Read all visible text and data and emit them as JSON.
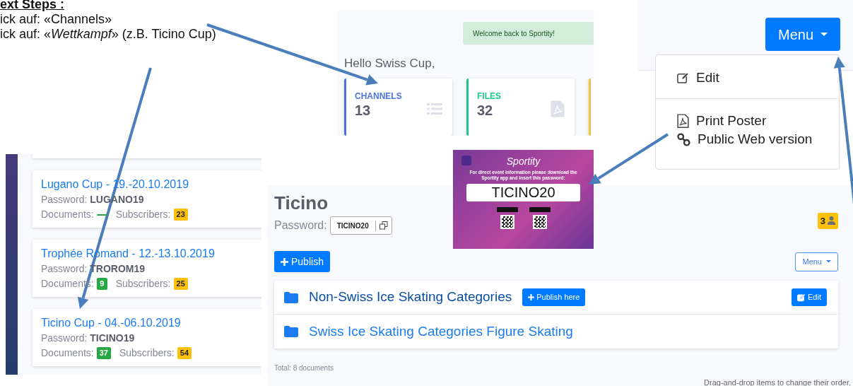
{
  "instructions": {
    "heading": "ext Steps :",
    "steps": [
      "ick auf: «Channels»",
      "ick auf: «*Wettkampf*» (z.B. Ticino Cup)"
    ]
  },
  "events": [
    {
      "title": "Lugano Cup - 19.-20.10.2019",
      "password_label": "Password:",
      "password": "LUGANO19",
      "documents_label": "Documents:",
      "subscribers_label": "Subscribers:",
      "subscribers": "23"
    },
    {
      "title": "Trophée Romand - 12.-13.10.2019",
      "password_label": "Password:",
      "password": "TROROM19",
      "documents_label": "Documents:",
      "documents": "9",
      "subscribers_label": "Subscribers:",
      "subscribers": "25"
    },
    {
      "title": "Ticino Cup - 04.-06.10.2019",
      "password_label": "Password:",
      "password": "TICINO19",
      "documents_label": "Documents:",
      "documents": "37",
      "subscribers_label": "Subscribers:",
      "subscribers": "54"
    }
  ],
  "dashboard": {
    "alert": "Welcome back to Sportity!",
    "greeting": "Hello Swiss Cup,",
    "stats": [
      {
        "label": "CHANNELS",
        "value": "13",
        "color": "#4e73df"
      },
      {
        "label": "FILES",
        "value": "32",
        "color": "#1cc88a"
      },
      {
        "color": "#f6c23e"
      }
    ]
  },
  "menu": {
    "button": "Menu",
    "items": [
      {
        "kind": "item",
        "label": "Edit"
      },
      {
        "kind": "divider"
      },
      {
        "kind": "item",
        "label": "Print Poster"
      },
      {
        "kind": "item",
        "label": "Public Web version"
      }
    ]
  },
  "poster": {
    "brand": "Sportity",
    "text": "For direct event information please download the Sportity app and insert this password:",
    "password": "TICINO20"
  },
  "channel": {
    "title": "Ticino",
    "password_label": "Password:",
    "password": "TICINO20",
    "subscribers": "3",
    "publish": "Publish",
    "menu": "Menu",
    "folders": [
      {
        "name": "Non-Swiss Ice Skating Categories",
        "hovered": true,
        "publish_here": "Publish here",
        "edit": "Edit"
      },
      {
        "name": "Swiss Ice Skating Categories Figure Skating",
        "hovered": false
      }
    ],
    "total": "Total: 8 documents",
    "hint": "Drag-and-drop items to change their order."
  }
}
